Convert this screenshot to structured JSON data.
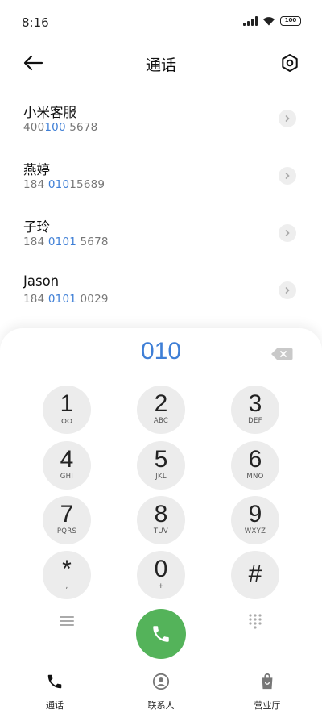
{
  "status_bar": {
    "time": "8:16",
    "battery": "100"
  },
  "header": {
    "title": "通话"
  },
  "contacts": [
    {
      "name": "小米客服",
      "number_parts": [
        "400",
        "100",
        " 5678"
      ]
    },
    {
      "name": "燕婷",
      "number_parts": [
        "184 ",
        "010",
        "15689"
      ]
    },
    {
      "name": "子玲",
      "number_parts": [
        "184 ",
        "0101",
        " 5678"
      ]
    },
    {
      "name": "Jason",
      "number_parts": [
        "184 ",
        "0101",
        " 0029"
      ]
    }
  ],
  "dialpad": {
    "input": "010",
    "keys": [
      {
        "digit": "1",
        "letters": ""
      },
      {
        "digit": "2",
        "letters": "ABC"
      },
      {
        "digit": "3",
        "letters": "DEF"
      },
      {
        "digit": "4",
        "letters": "GHI"
      },
      {
        "digit": "5",
        "letters": "JKL"
      },
      {
        "digit": "6",
        "letters": "MNO"
      },
      {
        "digit": "7",
        "letters": "PQRS"
      },
      {
        "digit": "8",
        "letters": "TUV"
      },
      {
        "digit": "9",
        "letters": "WXYZ"
      },
      {
        "digit": "*",
        "letters": ","
      },
      {
        "digit": "0",
        "letters": "+"
      },
      {
        "digit": "#",
        "letters": ""
      }
    ]
  },
  "nav": {
    "items": [
      {
        "label": "通话",
        "icon": "phone-icon"
      },
      {
        "label": "联系人",
        "icon": "contacts-icon"
      },
      {
        "label": "营业厅",
        "icon": "store-bag-icon"
      }
    ]
  },
  "colors": {
    "accent": "#3f7fd6",
    "call": "#54b35a"
  }
}
